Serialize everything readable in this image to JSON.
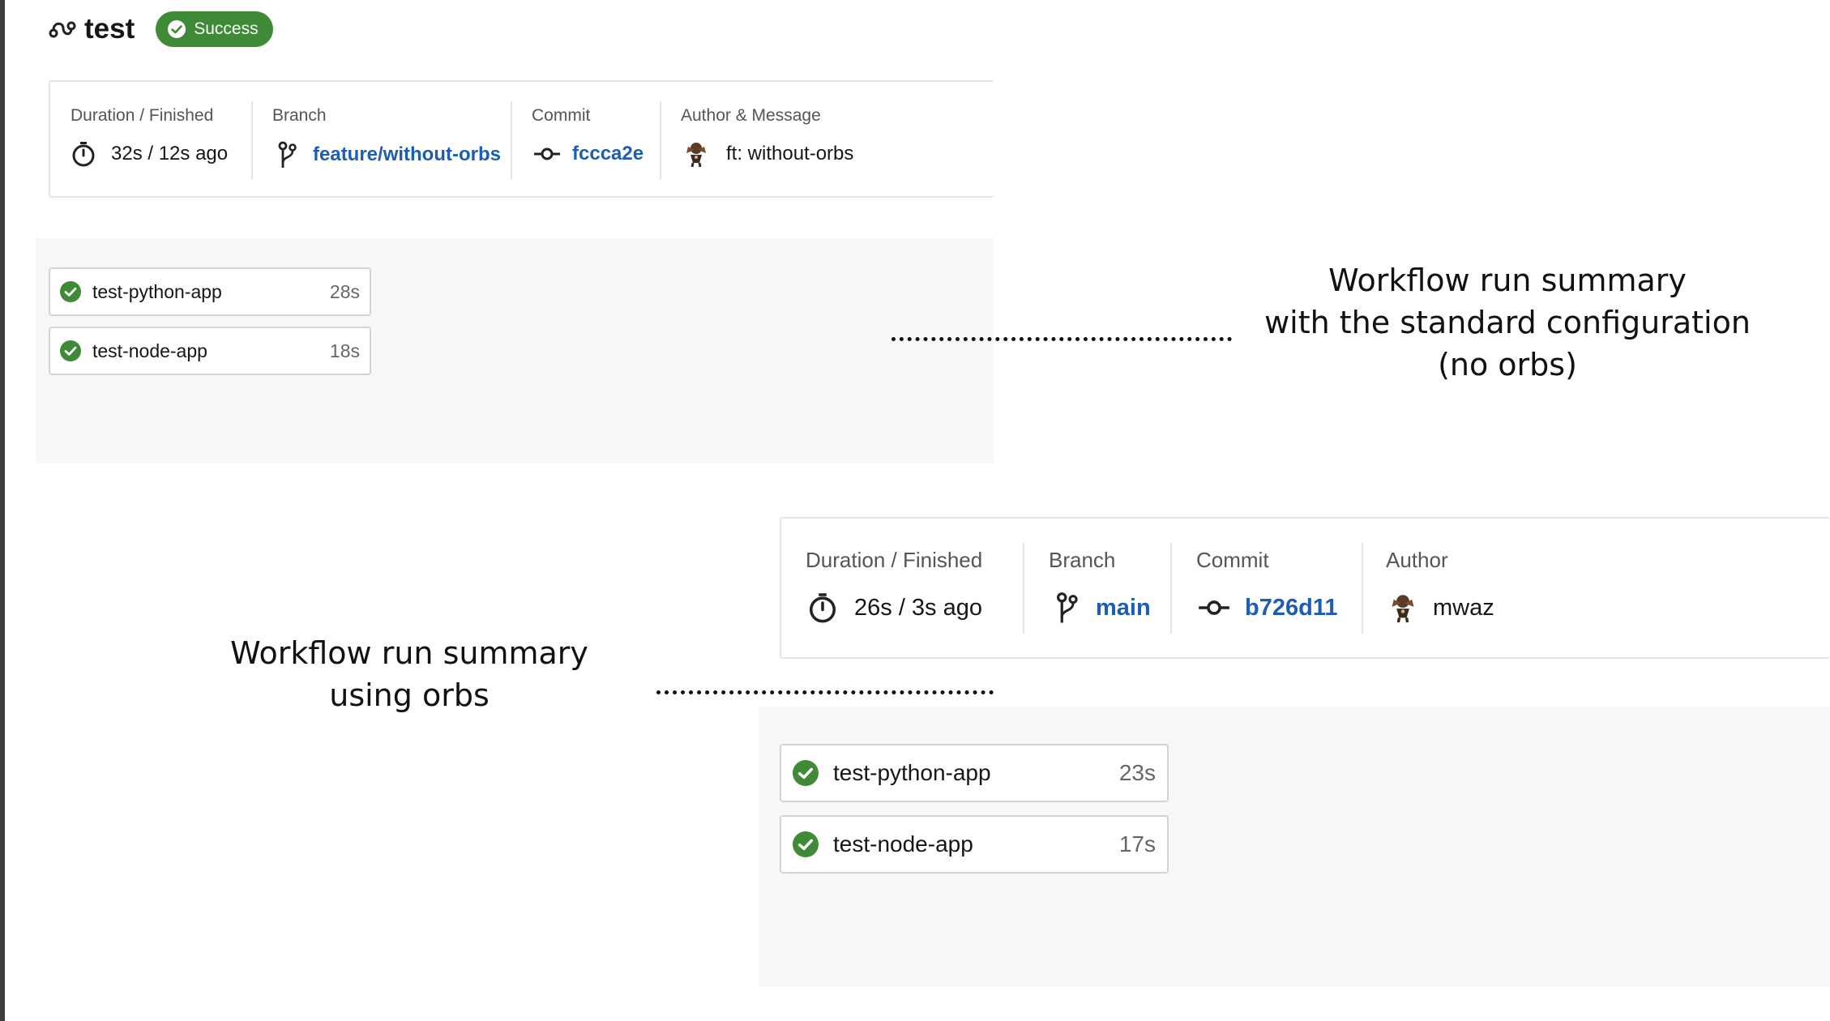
{
  "workflow": {
    "title": "test",
    "status": "Success",
    "colors": {
      "success": "#3e8a37",
      "link": "#1d5db3"
    }
  },
  "run_standard": {
    "labels": {
      "duration": "Duration / Finished",
      "branch": "Branch",
      "commit": "Commit",
      "author": "Author & Message"
    },
    "duration": "32s / 12s ago",
    "branch": "feature/without-orbs",
    "commit": "fccca2e",
    "message": "ft: without-orbs",
    "jobs": [
      {
        "name": "test-python-app",
        "duration": "28s"
      },
      {
        "name": "test-node-app",
        "duration": "18s"
      }
    ]
  },
  "run_orbs": {
    "labels": {
      "duration": "Duration / Finished",
      "branch": "Branch",
      "commit": "Commit",
      "author": "Author"
    },
    "duration": "26s / 3s ago",
    "branch": "main",
    "commit": "b726d11",
    "author": "mwaz",
    "jobs": [
      {
        "name": "test-python-app",
        "duration": "23s"
      },
      {
        "name": "test-node-app",
        "duration": "17s"
      }
    ]
  },
  "annotations": {
    "standard": [
      "Workflow run summary",
      "with the standard configuration",
      "(no orbs)"
    ],
    "orbs": [
      "Workflow run summary",
      "using orbs"
    ]
  }
}
